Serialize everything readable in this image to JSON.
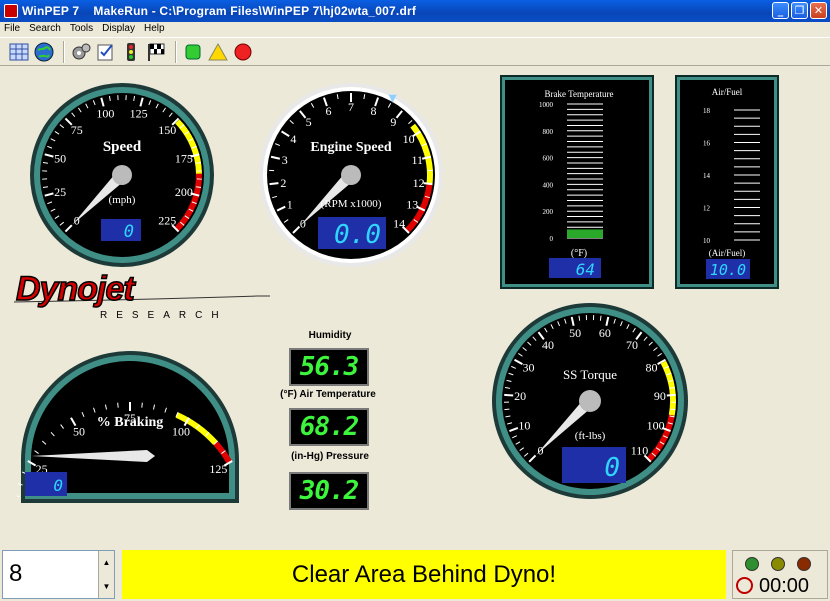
{
  "window": {
    "title": "WinPEP 7    MakeRun - C:\\Program Files\\WinPEP 7\\hj02wta_007.drf",
    "minimize": "_",
    "maximize": "❐",
    "close": "✕"
  },
  "menu": [
    "File",
    "Search",
    "Tools",
    "Display",
    "Help"
  ],
  "toolbar": {
    "icons": [
      "grid-icon",
      "globe-icon",
      "gears-icon",
      "edit-check-icon",
      "traffic-light-icon",
      "checkered-flag-icon",
      "green-button-icon",
      "yellow-triangle-icon",
      "red-stop-icon"
    ]
  },
  "gauges": {
    "speed": {
      "title": "Speed",
      "unit": "(mph)",
      "readout": "0",
      "ticks": [
        "0",
        "25",
        "50",
        "75",
        "100",
        "125",
        "150",
        "175",
        "200",
        "225"
      ]
    },
    "engine": {
      "title": "Engine Speed",
      "unit": "(RPM x1000)",
      "readout": "0.0",
      "ticks": [
        "0",
        "1",
        "2",
        "3",
        "4",
        "5",
        "6",
        "7",
        "8",
        "9",
        "10",
        "11",
        "12",
        "13",
        "14"
      ]
    },
    "braking": {
      "title": "% Braking",
      "readout": "0",
      "ticks": [
        "0",
        "25",
        "50",
        "75",
        "100",
        "125"
      ]
    },
    "torque": {
      "title": "SS Torque",
      "unit": "(ft-lbs)",
      "readout": "0",
      "ticks": [
        "0",
        "10",
        "20",
        "30",
        "40",
        "50",
        "60",
        "70",
        "80",
        "90",
        "100",
        "110"
      ]
    }
  },
  "bars": {
    "brake_temp": {
      "title": "Brake Temperature",
      "unit": "(°F)",
      "readout": "64",
      "ticks": [
        "0",
        "200",
        "400",
        "600",
        "800",
        "1000"
      ],
      "level": 0.064
    },
    "air_fuel": {
      "title": "Air/Fuel",
      "unit": "(Air/Fuel)",
      "readout": "10.0",
      "ticks": [
        "10",
        "12",
        "14",
        "16",
        "18"
      ]
    }
  },
  "logo": {
    "name": "Dynojet",
    "sub": "RESEARCH"
  },
  "readouts": {
    "humidity_label": "Humidity",
    "humidity": "56.3",
    "air_temp_label": "(°F) Air Temperature",
    "air_temp": "68.2",
    "pressure_label": "(in-Hg) Pressure",
    "pressure": "30.2"
  },
  "status": {
    "spin_value": "8",
    "message": "Clear Area Behind Dyno!",
    "timer": "00:00"
  },
  "colors": {
    "bezel": "#3f8f86",
    "readout_blue": "#1f2fa8",
    "readout_digits": "#2fd6ff",
    "led_green": "#3cf53c",
    "message_bg": "#ffff00",
    "yellow_zone": "#ffff00",
    "red_zone": "#e00000"
  }
}
